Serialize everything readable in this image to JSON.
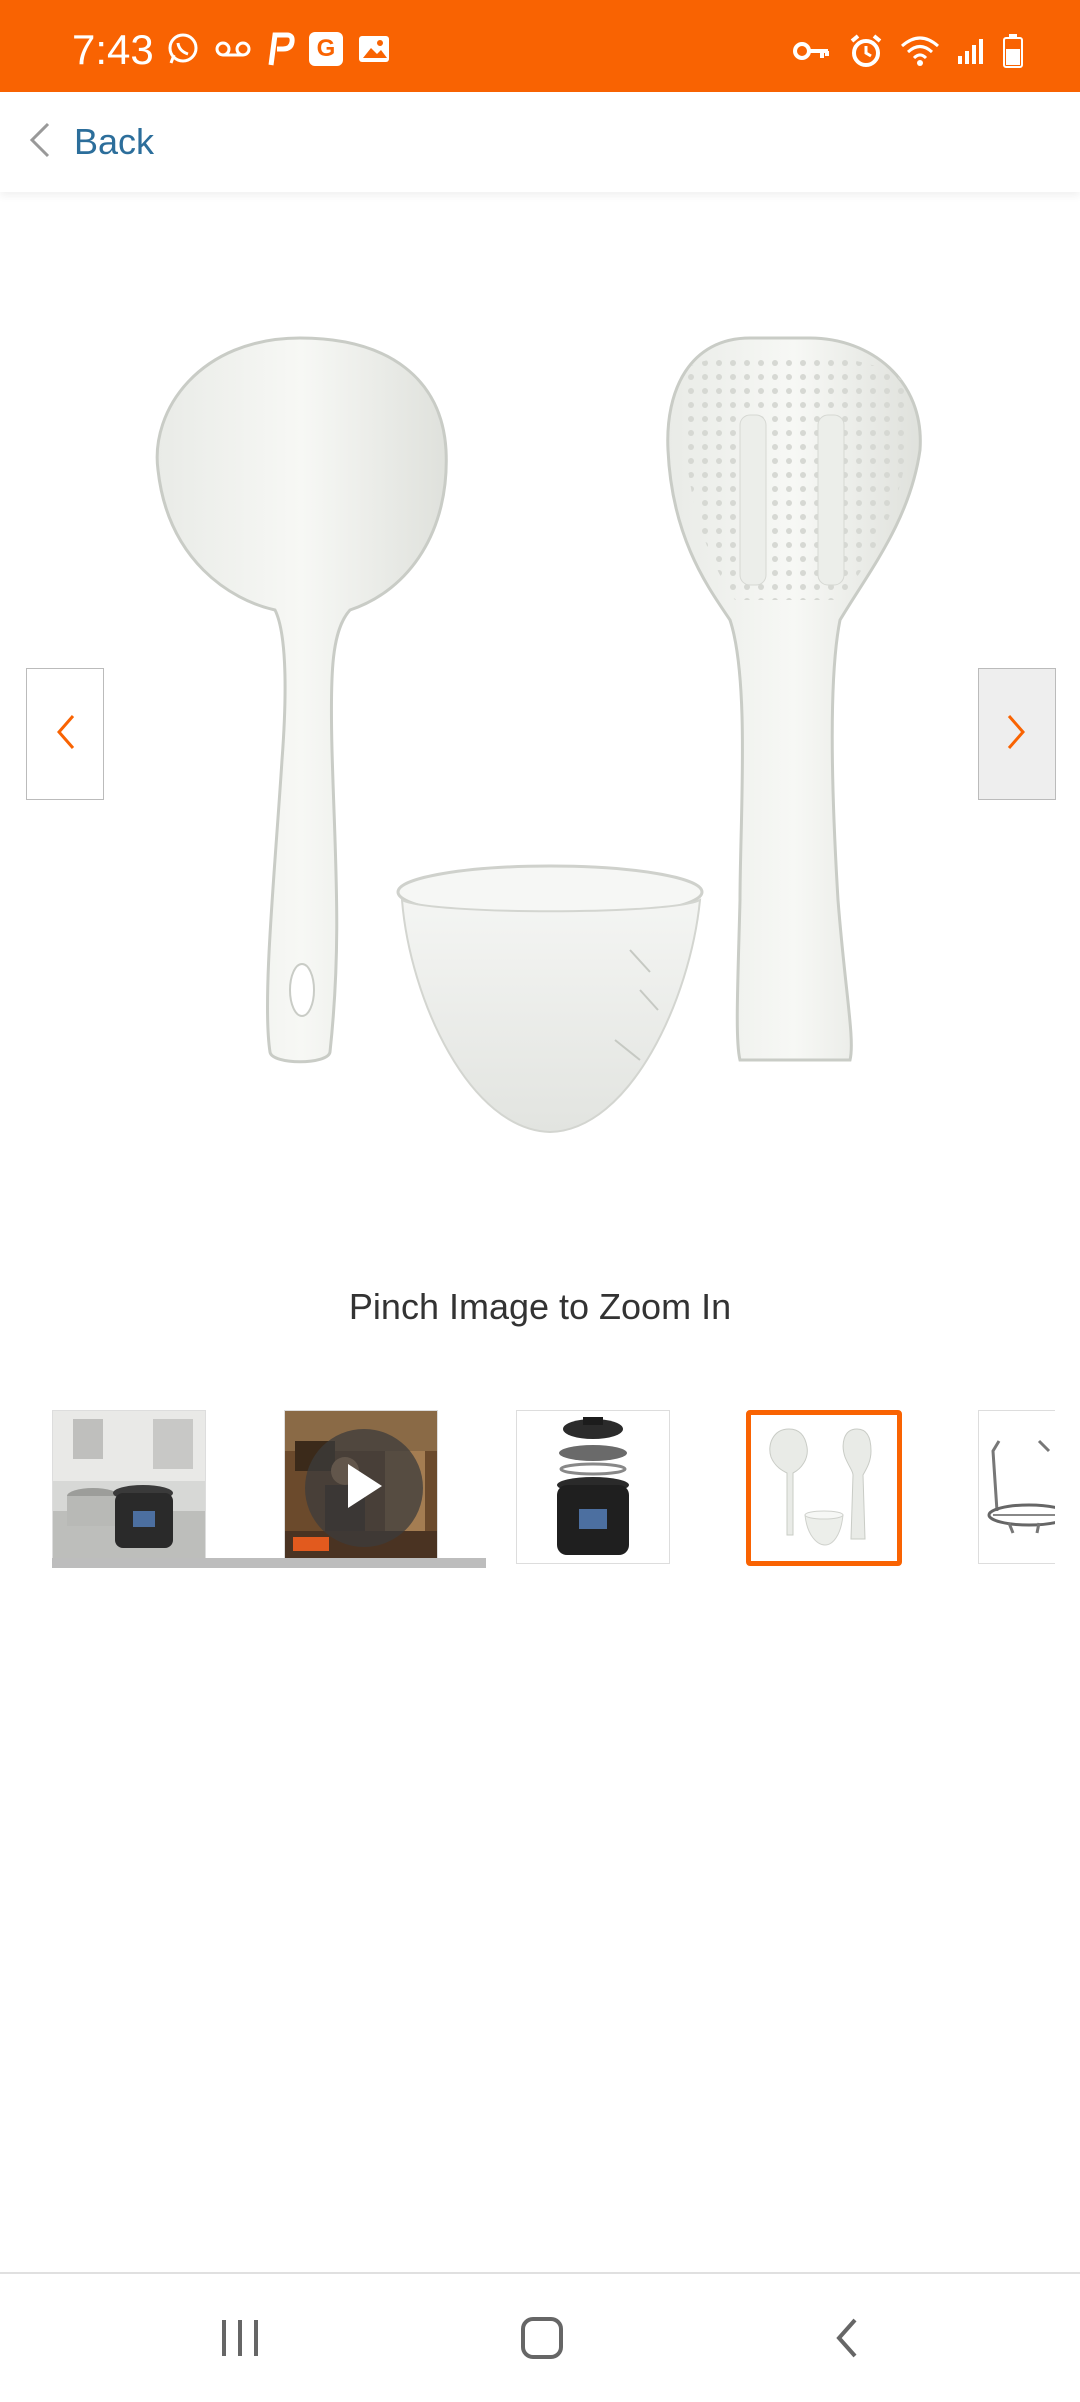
{
  "status_bar": {
    "time": "7:43",
    "left_icons": [
      "whatsapp-icon",
      "voicemail-icon",
      "p-app-icon",
      "g-app-icon",
      "gallery-icon"
    ],
    "g_app_letter": "G",
    "right_icons": [
      "vpn-key-icon",
      "alarm-icon",
      "wifi-icon",
      "signal-icon",
      "battery-icon"
    ],
    "color": "#f96302"
  },
  "header": {
    "back_label": "Back"
  },
  "gallery": {
    "main_image_alt": "Rice spoon, soup ladle and measuring cup",
    "pinch_text": "Pinch Image to Zoom In",
    "selected_index": 3,
    "thumbnails": [
      {
        "name": "kitchen-scene",
        "video": false
      },
      {
        "name": "video",
        "video": true
      },
      {
        "name": "cooker-exploded",
        "video": false
      },
      {
        "name": "utensils",
        "video": false,
        "selected": true
      },
      {
        "name": "steam-rack",
        "video": false
      }
    ]
  },
  "colors": {
    "accent": "#f96302",
    "link": "#2c6e9b"
  }
}
